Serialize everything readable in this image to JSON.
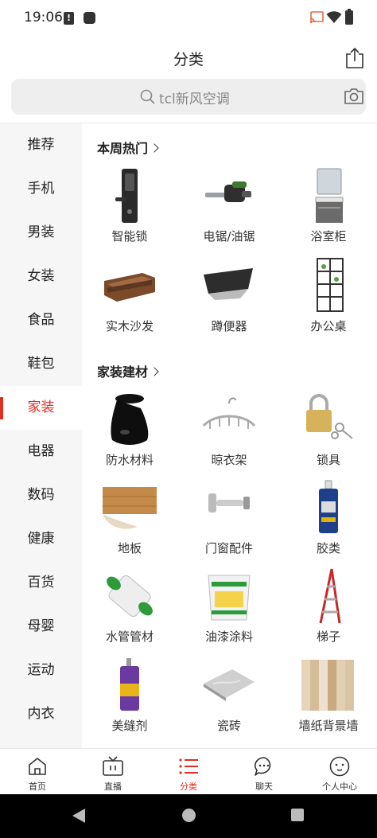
{
  "status": {
    "time": "19:06"
  },
  "header": {
    "title": "分类"
  },
  "search": {
    "placeholder": "tcl新风空调"
  },
  "sidebar": {
    "items": [
      {
        "label": "推荐"
      },
      {
        "label": "手机"
      },
      {
        "label": "男装"
      },
      {
        "label": "女装"
      },
      {
        "label": "食品"
      },
      {
        "label": "鞋包"
      },
      {
        "label": "家装"
      },
      {
        "label": "电器"
      },
      {
        "label": "数码"
      },
      {
        "label": "健康"
      },
      {
        "label": "百货"
      },
      {
        "label": "母婴"
      },
      {
        "label": "运动"
      },
      {
        "label": "内衣"
      }
    ],
    "active_label": "家装"
  },
  "sections": {
    "hot": {
      "title": "本周热门",
      "items": [
        {
          "label": "智能锁",
          "icon": "smart-lock-icon"
        },
        {
          "label": "电锯/油锯",
          "icon": "chainsaw-icon"
        },
        {
          "label": "浴室柜",
          "icon": "bathroom-cabinet-icon"
        },
        {
          "label": "实木沙发",
          "icon": "wood-sofa-icon"
        },
        {
          "label": "蹲便器",
          "icon": "squat-toilet-icon"
        },
        {
          "label": "办公桌",
          "icon": "office-desk-icon"
        }
      ]
    },
    "building": {
      "title": "家装建材",
      "items": [
        {
          "label": "防水材料",
          "icon": "waterproof-material-icon"
        },
        {
          "label": "晾衣架",
          "icon": "clothes-hanger-icon"
        },
        {
          "label": "锁具",
          "icon": "padlock-icon"
        },
        {
          "label": "地板",
          "icon": "floor-plank-icon"
        },
        {
          "label": "门窗配件",
          "icon": "door-hardware-icon"
        },
        {
          "label": "胶类",
          "icon": "glue-tube-icon"
        },
        {
          "label": "水管管材",
          "icon": "water-pipe-icon"
        },
        {
          "label": "油漆涂料",
          "icon": "paint-bucket-icon"
        },
        {
          "label": "梯子",
          "icon": "ladder-icon"
        },
        {
          "label": "美缝剂",
          "icon": "grout-sealant-icon"
        },
        {
          "label": "瓷砖",
          "icon": "ceramic-tile-icon"
        },
        {
          "label": "墙纸背景墙",
          "icon": "wallpaper-icon"
        }
      ]
    }
  },
  "tabbar": {
    "items": [
      {
        "label": "首页",
        "icon": "home-icon"
      },
      {
        "label": "直播",
        "icon": "live-tv-icon"
      },
      {
        "label": "分类",
        "icon": "category-list-icon"
      },
      {
        "label": "聊天",
        "icon": "chat-bubble-icon"
      },
      {
        "label": "个人中心",
        "icon": "profile-face-icon"
      }
    ],
    "active_label": "分类"
  },
  "colors": {
    "accent": "#e02e24",
    "sidebar_bg": "#f6f6f6",
    "search_bg": "#eeeeee"
  }
}
